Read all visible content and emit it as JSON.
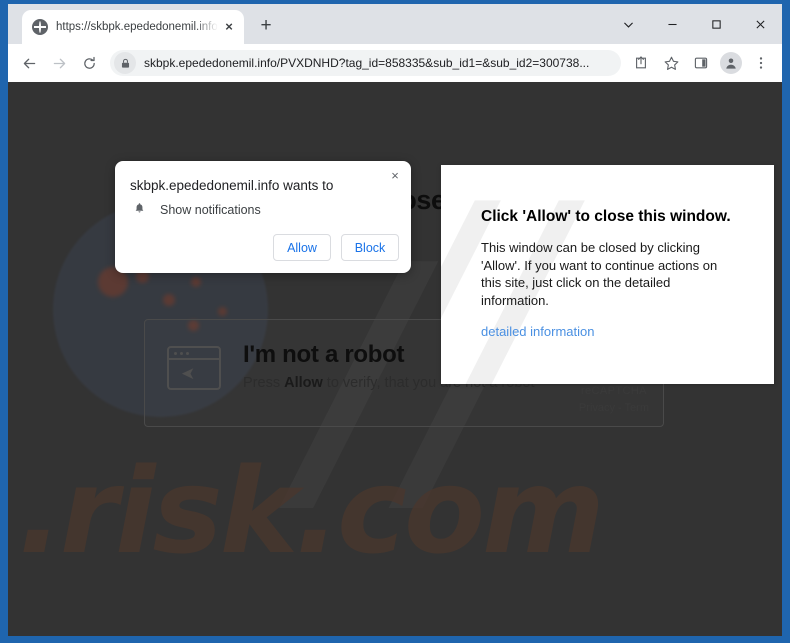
{
  "window": {
    "controls": {
      "tab_search": "tab-search-chevron",
      "minimize": "minimize",
      "maximize": "maximize",
      "close": "close"
    }
  },
  "tabstrip": {
    "tab": {
      "title": "https://skbpk.epededonemil.info",
      "favicon": "globe-icon",
      "close_label": "×"
    },
    "new_tab_label": "+"
  },
  "toolbar": {
    "back_icon": "back-arrow-icon",
    "forward_icon": "forward-arrow-icon",
    "reload_icon": "reload-icon",
    "lock_icon": "lock-icon",
    "url": "skbpk.epededonemil.info/PVXDNHD?tag_id=858335&sub_id1=&sub_id2=300738...",
    "share_icon": "share-icon",
    "bookmark_icon": "star-icon",
    "side_panel_icon": "side-panel-icon",
    "profile_icon": "profile-avatar-icon",
    "menu_icon": "three-dot-menu-icon"
  },
  "page": {
    "hidden_headline": "Click 'Allow' to close this window.",
    "watermark": ".risk.com",
    "watermark_slashes": "//",
    "captcha": {
      "title": "I'm not a robot",
      "subtitle_prefix": "Press ",
      "subtitle_bold": "Allow",
      "subtitle_suffix": " to verify, that you are not a robot",
      "icon": "browser-window-cursor-icon",
      "badge_brand": "reCAPTCHA",
      "badge_links": "Privacy - Term"
    }
  },
  "permission_bubble": {
    "title": "skbpk.epededonemil.info wants to",
    "permission_icon": "bell-icon",
    "permission_label": "Show notifications",
    "allow_label": "Allow",
    "block_label": "Block",
    "close_label": "×"
  },
  "scam_popup": {
    "watermark": "//",
    "title": "Click 'Allow' to close this window.",
    "body": "This window can be closed by clicking 'Allow'. If you want to continue actions on this site, just click on the detailed information.",
    "link": "detailed information"
  },
  "colors": {
    "frame_blue": "#1f65ae",
    "page_dark": "#333333",
    "chrome_toolbar": "#ffffff",
    "tabstrip": "#dee1e6",
    "accent_blue": "#1a73e8",
    "link_blue": "#4a90e2"
  }
}
